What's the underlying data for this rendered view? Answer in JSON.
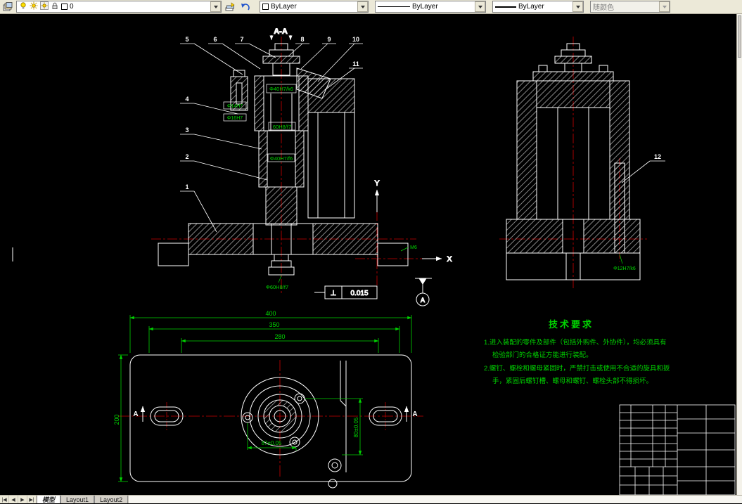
{
  "toolbar": {
    "layer": {
      "value": "0"
    },
    "color": {
      "value": "ByLayer"
    },
    "linetype": {
      "value": "ByLayer"
    },
    "lineweight": {
      "value": "ByLayer"
    },
    "plot_style": {
      "value": "随颜色"
    }
  },
  "tabs": {
    "model": "模型",
    "layout1": "Layout1",
    "layout2": "Layout2"
  },
  "drawing": {
    "section_label": "A-A",
    "axis_x": "X",
    "axis_y": "Y",
    "balloons": {
      "n1": "1",
      "n2": "2",
      "n3": "3",
      "n4": "4",
      "n5": "5",
      "n6": "6",
      "n7": "7",
      "n8": "8",
      "n9": "9",
      "n10": "10",
      "n11": "11",
      "n12": "12"
    },
    "front_dims": {
      "bore_top": "Φ40H7/k6",
      "pin_small": "Φ14H7",
      "pin_large": "Φ16H7",
      "fit_60": "60H8/f7",
      "bore_mid": "Φ40H7/f6",
      "bore_base": "Φ60H8/f7",
      "thread": "M6"
    },
    "tolerance": {
      "symbol": "⊥",
      "value": "0.015",
      "datum": "A"
    },
    "side_dims": {
      "pin12": "Φ12H7/k6"
    },
    "plan": {
      "dim_400": "400",
      "dim_350": "350",
      "dim_280": "280",
      "dim_200": "200",
      "dim_87": "87±0.05",
      "dim_80": "80±0.05",
      "section_mark": "A"
    },
    "tech_requirements": {
      "title": "技术要求",
      "line1": "1.进入装配的零件及部件（包括外购件、外协件），均必须具有",
      "line2": "检验部门的合格证方能进行装配。",
      "line3": "2.螺钉、螺栓和螺母紧固时，严禁打击或使用不合适的旋具和扳",
      "line4": "手，紧固后螺钉槽、螺母和螺钉、螺栓头部不得损坏。"
    }
  }
}
